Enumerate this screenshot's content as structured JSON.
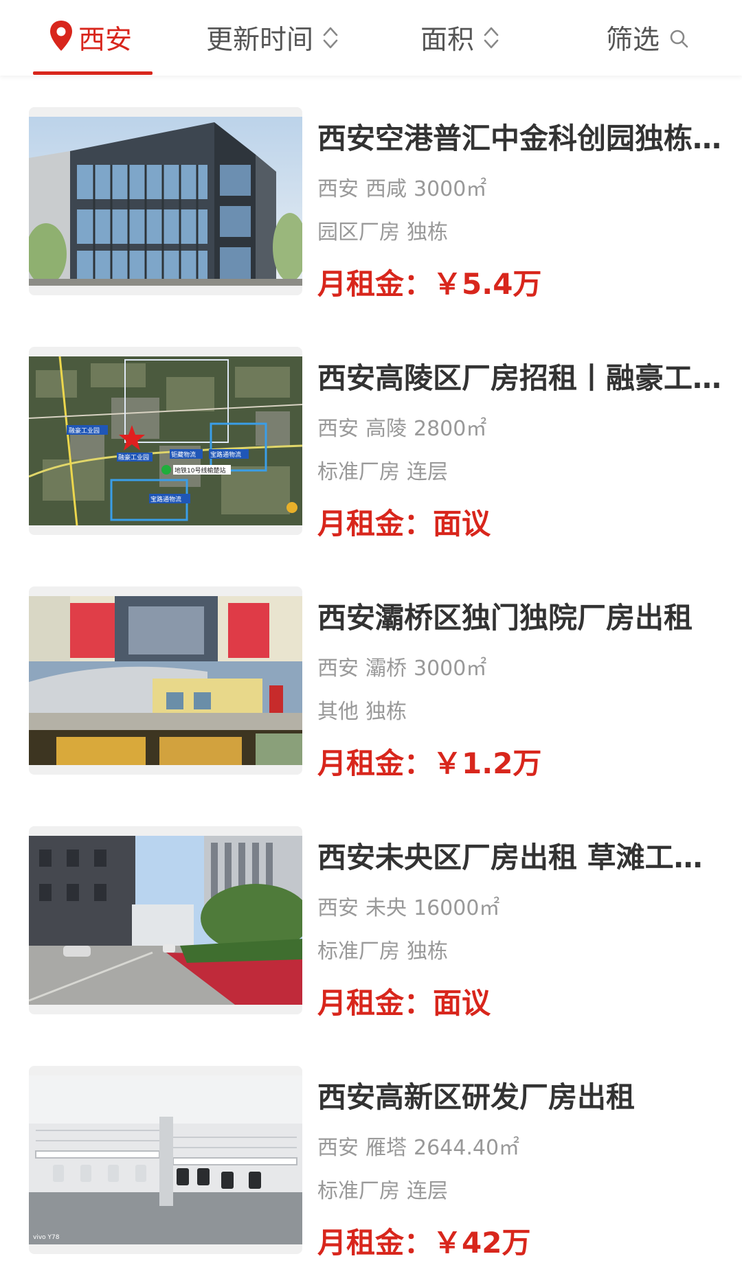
{
  "filter_bar": {
    "city": "西安",
    "update_time": "更新时间",
    "area": "面积",
    "filter": "筛选"
  },
  "colors": {
    "accent": "#d8261c",
    "title_text": "#333333",
    "meta_text": "#999999"
  },
  "listings": [
    {
      "title": "西安空港普汇中金科创园独栋厂房",
      "city": "西安",
      "district": "西咸",
      "area": "3000㎡",
      "category": "园区厂房",
      "layout": "独栋",
      "rent_label": "月租金：",
      "rent": "￥5.4万"
    },
    {
      "title": "西安高陵区厂房招租丨融豪工业园",
      "city": "西安",
      "district": "高陵",
      "area": "2800㎡",
      "category": "标准厂房",
      "layout": "连层",
      "rent_label": "月租金：",
      "rent": "面议",
      "map_labels": [
        "融豪工业园",
        "融豪工业园",
        "钜藏物流",
        "宝路通物流",
        "地铁10号线榆楚站",
        "宝路通物流"
      ]
    },
    {
      "title": "西安灞桥区独门独院厂房出租",
      "city": "西安",
      "district": "灞桥",
      "area": "3000㎡",
      "category": "其他",
      "layout": "独栋",
      "rent_label": "月租金：",
      "rent": "￥1.2万"
    },
    {
      "title": "西安未央区厂房出租 草滩工业园",
      "city": "西安",
      "district": "未央",
      "area": "16000㎡",
      "category": "标准厂房",
      "layout": "独栋",
      "rent_label": "月租金：",
      "rent": "面议"
    },
    {
      "title": "西安高新区研发厂房出租",
      "city": "西安",
      "district": "雁塔",
      "area": "2644.40㎡",
      "category": "标准厂房",
      "layout": "连层",
      "rent_label": "月租金：",
      "rent": "￥42万",
      "photo_watermark": "vivo Y78"
    }
  ]
}
